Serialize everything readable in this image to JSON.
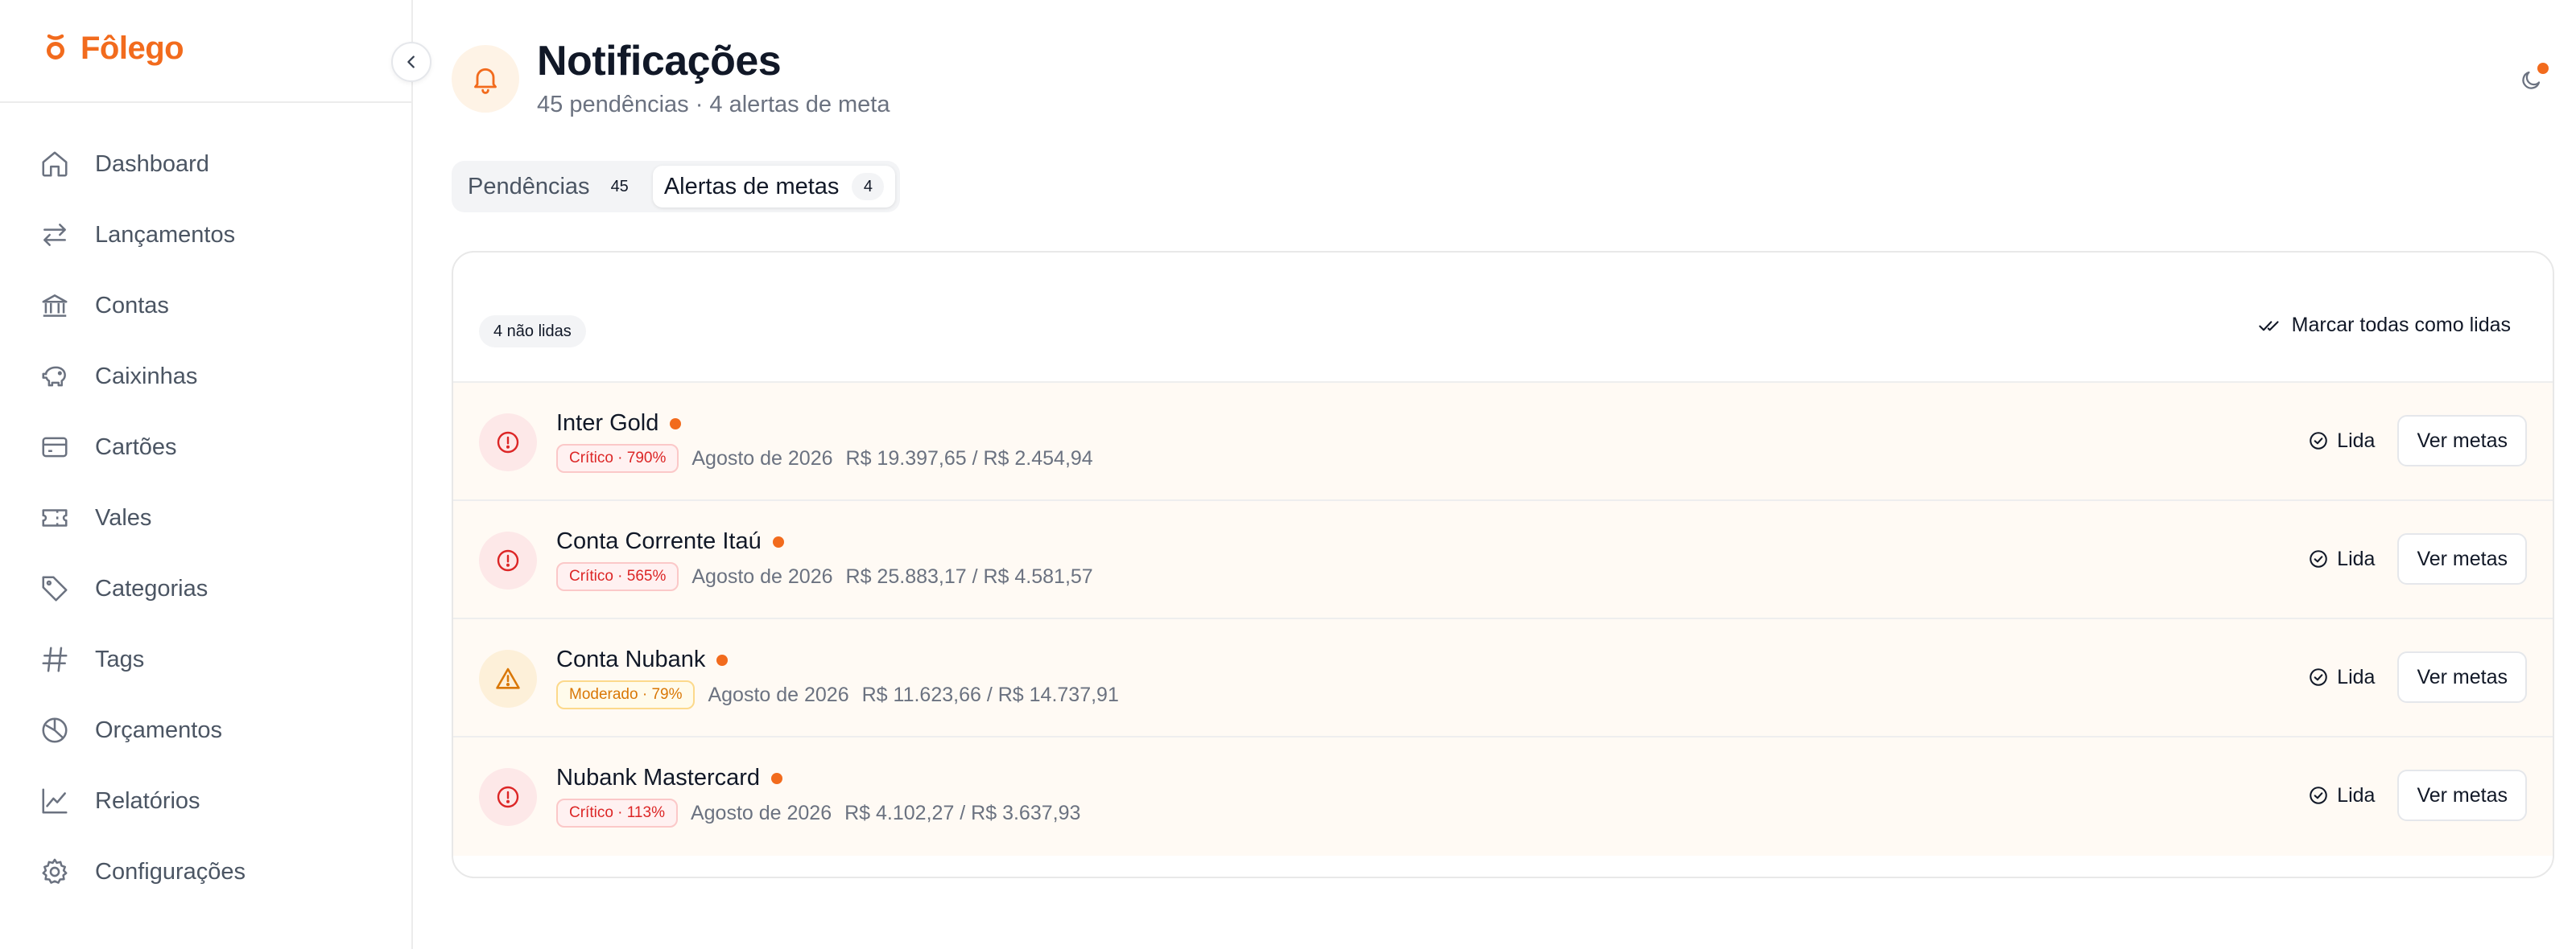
{
  "brand": {
    "name": "Fôlego",
    "accent": "#f26b1d"
  },
  "sidebar": {
    "items": [
      {
        "label": "Dashboard",
        "icon": "home-icon"
      },
      {
        "label": "Lançamentos",
        "icon": "arrows-exchange-icon"
      },
      {
        "label": "Contas",
        "icon": "bank-icon"
      },
      {
        "label": "Caixinhas",
        "icon": "piggy-bank-icon"
      },
      {
        "label": "Cartões",
        "icon": "credit-card-icon"
      },
      {
        "label": "Vales",
        "icon": "ticket-icon"
      },
      {
        "label": "Categorias",
        "icon": "tag-icon"
      },
      {
        "label": "Tags",
        "icon": "hash-icon"
      },
      {
        "label": "Orçamentos",
        "icon": "pie-chart-icon"
      },
      {
        "label": "Relatórios",
        "icon": "line-chart-icon"
      },
      {
        "label": "Configurações",
        "icon": "gear-icon"
      }
    ]
  },
  "header": {
    "title": "Notificações",
    "subtitle": "45 pendências · 4 alertas de meta"
  },
  "tabs": [
    {
      "label": "Pendências",
      "count": "45",
      "active": false
    },
    {
      "label": "Alertas de metas",
      "count": "4",
      "active": true
    }
  ],
  "alerts": {
    "unread_label": "4 não lidas",
    "mark_all_label": "Marcar todas como lidas",
    "read_label": "Lida",
    "view_label": "Ver metas",
    "items": [
      {
        "name": "Inter Gold",
        "severity": "crit",
        "badge": "Crítico · 790%",
        "period": "Agosto de 2026",
        "amounts": "R$ 19.397,65 / R$ 2.454,94"
      },
      {
        "name": "Conta Corrente Itaú",
        "severity": "crit",
        "badge": "Crítico · 565%",
        "period": "Agosto de 2026",
        "amounts": "R$ 25.883,17 / R$ 4.581,57"
      },
      {
        "name": "Conta Nubank",
        "severity": "mod",
        "badge": "Moderado · 79%",
        "period": "Agosto de 2026",
        "amounts": "R$ 11.623,66 / R$ 14.737,91"
      },
      {
        "name": "Nubank Mastercard",
        "severity": "crit",
        "badge": "Crítico · 113%",
        "period": "Agosto de 2026",
        "amounts": "R$ 4.102,27 / R$ 3.637,93"
      }
    ]
  },
  "colors": {
    "critical": "#dc2626",
    "moderate": "#d97706",
    "unread_dot": "#f26b1d",
    "row_bg": "#fffaf4"
  }
}
